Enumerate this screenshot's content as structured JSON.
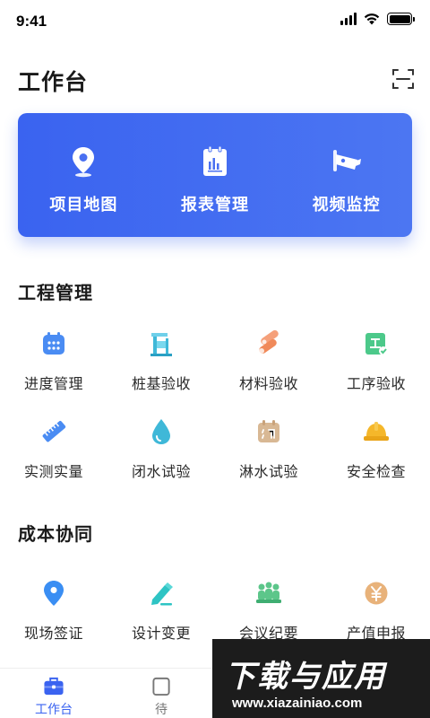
{
  "status_bar": {
    "time": "9:41"
  },
  "header": {
    "title": "工作台"
  },
  "hero": {
    "items": [
      {
        "label": "项目地图",
        "icon": "location-pin-icon"
      },
      {
        "label": "报表管理",
        "icon": "report-clipboard-icon"
      },
      {
        "label": "视频监控",
        "icon": "security-camera-icon"
      }
    ]
  },
  "sections": [
    {
      "title": "工程管理",
      "items": [
        {
          "label": "进度管理",
          "icon": "calendar-icon",
          "color": "#4a8cf3"
        },
        {
          "label": "桩基验收",
          "icon": "pile-driver-icon",
          "color": "#3fb8d8"
        },
        {
          "label": "材料验收",
          "icon": "material-pipes-icon",
          "color": "#f08a5a"
        },
        {
          "label": "工序验收",
          "icon": "process-check-icon",
          "color": "#4cc98a"
        },
        {
          "label": "实测实量",
          "icon": "ruler-icon",
          "color": "#4a8cf3"
        },
        {
          "label": "闭水试验",
          "icon": "water-drop-icon",
          "color": "#3fb8d8"
        },
        {
          "label": "淋水试验",
          "icon": "rain-test-icon",
          "color": "#c9a27a"
        },
        {
          "label": "安全检查",
          "icon": "safety-helmet-icon",
          "color": "#f5b72a"
        }
      ]
    },
    {
      "title": "成本协同",
      "items": [
        {
          "label": "现场签证",
          "icon": "location-pin-icon",
          "color": "#3a8ef3"
        },
        {
          "label": "设计变更",
          "icon": "design-pen-icon",
          "color": "#2ec4c4"
        },
        {
          "label": "会议纪要",
          "icon": "meeting-people-icon",
          "color": "#5cc68a"
        },
        {
          "label": "产值申报",
          "icon": "yuan-coin-icon",
          "color": "#e8b27a"
        }
      ]
    }
  ],
  "tab_bar": {
    "tabs": [
      {
        "label": "工作台",
        "active": true
      },
      {
        "label": "待",
        "active": false
      }
    ]
  },
  "watermark": {
    "title": "下载与应用",
    "url": "www.xiazainiao.com"
  }
}
